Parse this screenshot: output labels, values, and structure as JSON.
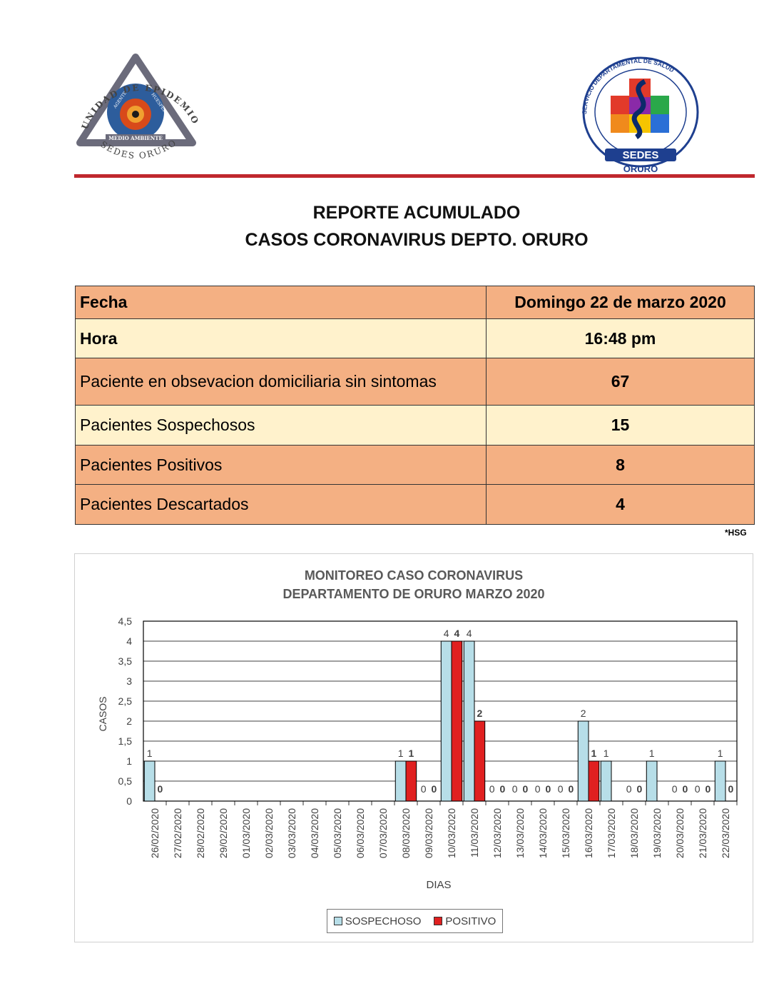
{
  "header": {
    "left_logo": {
      "icon": "epidemiology-unit-logo",
      "text_top": "UNIDAD DE EPIDEMIOLOGIA",
      "text_bottom": "SEDES ORURO",
      "inner_labels": [
        "AGENTE",
        "HUESPED",
        "MEDIO AMBIENTE"
      ]
    },
    "right_logo": {
      "icon": "sedes-oruro-logo",
      "ring_text": "SERVICIO DEPARTAMENTAL DE SALUD",
      "brand": "SEDES",
      "city": "ORURO"
    },
    "accent_line_color": "#c0272d"
  },
  "title": {
    "line1": "REPORTE ACUMULADO",
    "line2": "CASOS CORONAVIRUS DEPTO. ORURO"
  },
  "report_table": {
    "rows": [
      {
        "label": "Fecha",
        "value": "Domingo 22 de marzo 2020",
        "style": "orange"
      },
      {
        "label": "Hora",
        "value": "16:48 pm",
        "style": "cream"
      },
      {
        "label": "Paciente en obsevacion domiciliaria sin sintomas",
        "value": "67",
        "style": "orange"
      },
      {
        "label": "Pacientes Sospechosos",
        "value": "15",
        "style": "cream"
      },
      {
        "label": "Pacientes Positivos",
        "value": "8",
        "style": "orange"
      },
      {
        "label": "Pacientes Descartados",
        "value": "4",
        "style": "orange"
      }
    ],
    "colors": {
      "orange": "#f4b083",
      "cream": "#fff2cc"
    },
    "footnote": "*HSG"
  },
  "chart_data": {
    "type": "bar",
    "title_line1": "MONITOREO CASO CORONAVIRUS",
    "title_line2": "DEPARTAMENTO DE ORURO MARZO 2020",
    "xlabel": "DIAS",
    "ylabel": "CASOS",
    "ylim": [
      0,
      4.5
    ],
    "yticks": [
      "0",
      "0,5",
      "1",
      "1,5",
      "2",
      "2,5",
      "3",
      "3,5",
      "4",
      "4,5"
    ],
    "grid": true,
    "legend_position": "bottom",
    "categories": [
      "26/02/2020",
      "27/02/2020",
      "28/02/2020",
      "29/02/2020",
      "01/03/2020",
      "02/03/2020",
      "03/03/2020",
      "04/03/2020",
      "05/03/2020",
      "06/03/2020",
      "07/03/2020",
      "08/03/2020",
      "09/03/2020",
      "10/03/2020",
      "11/03/2020",
      "12/03/2020",
      "13/03/2020",
      "14/03/2020",
      "15/03/2020",
      "16/03/2020",
      "17/03/2020",
      "18/03/2020",
      "19/03/2020",
      "20/03/2020",
      "21/03/2020",
      "22/03/2020"
    ],
    "series": [
      {
        "name": "SOSPECHOSO",
        "color": "#b7dee8",
        "values": [
          1,
          null,
          null,
          null,
          null,
          null,
          null,
          null,
          null,
          null,
          null,
          1,
          0,
          4,
          4,
          0,
          0,
          0,
          0,
          2,
          1,
          0,
          1,
          0,
          0,
          1
        ],
        "labels": [
          "1",
          "",
          "",
          "",
          "",
          "",
          "",
          "",
          "",
          "",
          "",
          "1",
          "0",
          "4",
          "4",
          "0",
          "0",
          "0",
          "0",
          "2",
          "1",
          "0",
          "1",
          "0",
          "0",
          "1"
        ]
      },
      {
        "name": "POSITIVO",
        "color": "#e02020",
        "values": [
          0,
          null,
          null,
          null,
          null,
          null,
          null,
          null,
          null,
          null,
          null,
          1,
          0,
          4,
          2,
          0,
          0,
          0,
          0,
          1,
          null,
          0,
          null,
          0,
          0,
          0
        ],
        "labels": [
          "0",
          "",
          "",
          "",
          "",
          "",
          "",
          "",
          "",
          "",
          "",
          "1",
          "0",
          "4",
          "2",
          "0",
          "0",
          "0",
          "0",
          "1",
          "",
          "0",
          "",
          "0",
          "0",
          "0"
        ]
      }
    ]
  }
}
